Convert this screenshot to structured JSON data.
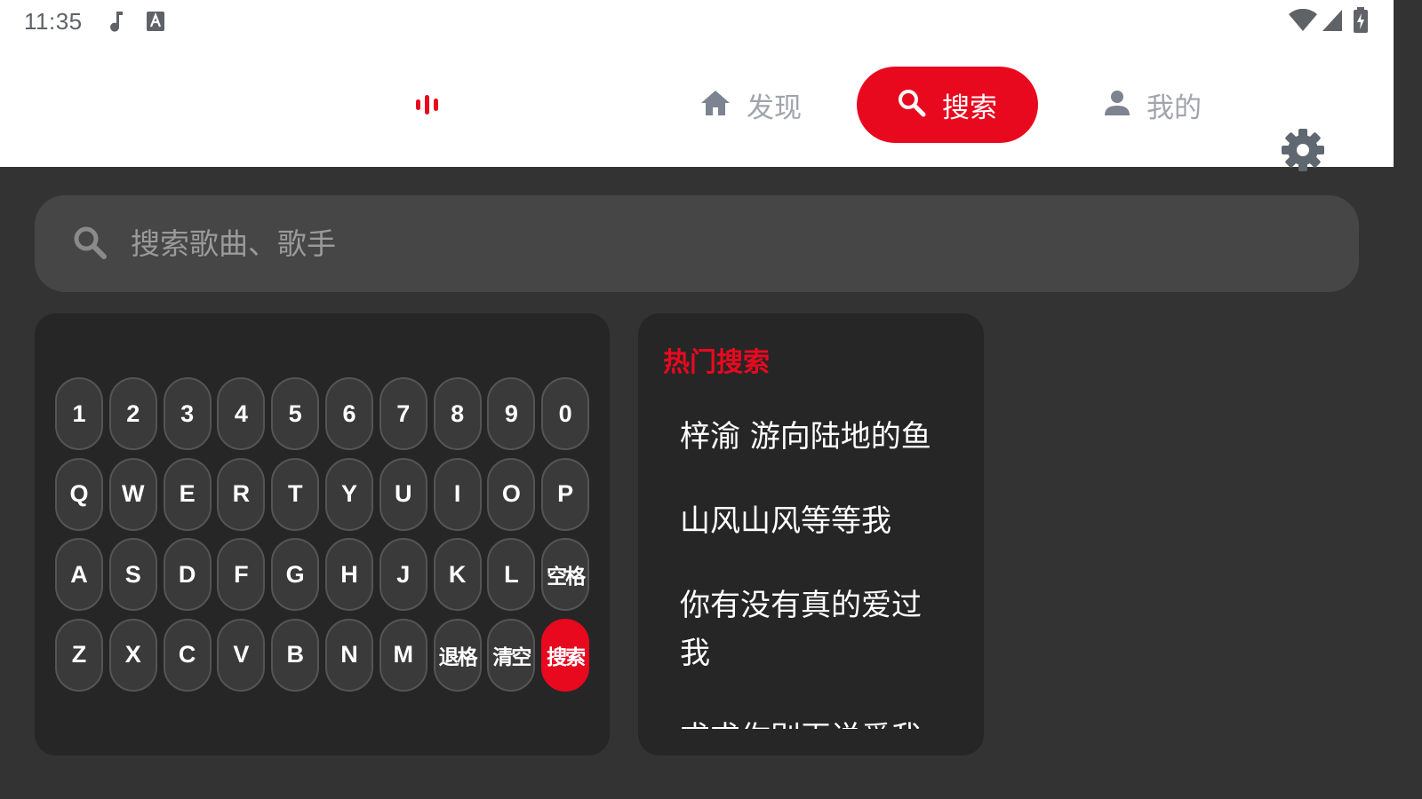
{
  "status_bar": {
    "time": "11:35",
    "left_icons": [
      "music-note-icon",
      "font-a-icon"
    ],
    "right_icons": [
      "wifi-icon",
      "cell-signal-icon",
      "battery-charging-icon"
    ]
  },
  "nav": {
    "logo_icon": "equalizer-bars-icon",
    "items": [
      {
        "label": "发现",
        "icon": "home-icon",
        "active": false
      },
      {
        "label": "搜索",
        "icon": "search-icon",
        "active": true
      },
      {
        "label": "我的",
        "icon": "person-icon",
        "active": false
      }
    ],
    "settings_icon": "gear-icon"
  },
  "search": {
    "placeholder": "搜索歌曲、歌手",
    "value": ""
  },
  "keyboard": {
    "rows": [
      [
        "1",
        "2",
        "3",
        "4",
        "5",
        "6",
        "7",
        "8",
        "9",
        "0"
      ],
      [
        "Q",
        "W",
        "E",
        "R",
        "T",
        "Y",
        "U",
        "I",
        "O",
        "P"
      ],
      [
        "A",
        "S",
        "D",
        "F",
        "G",
        "H",
        "J",
        "K",
        "L",
        "空格"
      ],
      [
        "Z",
        "X",
        "C",
        "V",
        "B",
        "N",
        "M",
        "退格",
        "清空",
        "搜索"
      ]
    ]
  },
  "hot_search": {
    "title": "热门搜索",
    "items": [
      "梓渝 游向陆地的鱼",
      "山风山风等等我",
      "你有没有真的爱过我",
      "求求你别再说爱我"
    ]
  },
  "colors": {
    "accent": "#e8091f",
    "background": "#333333",
    "panel": "#262626",
    "search_bar": "#464646",
    "nav_inactive": "#a0a4ac"
  }
}
